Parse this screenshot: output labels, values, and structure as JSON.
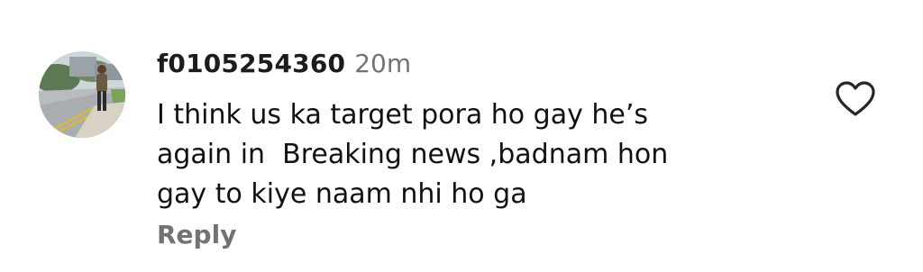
{
  "comment": {
    "username": "f0105254360",
    "timestamp": "20m",
    "text": "I think us ka target pora ho gay he’s\nagain in  Breaking news ,badnam hon\ngay to kiye naam nhi ho ga",
    "reply_label": "Reply",
    "avatar": "user-profile-photo",
    "like_icon": "heart-outline-icon"
  }
}
